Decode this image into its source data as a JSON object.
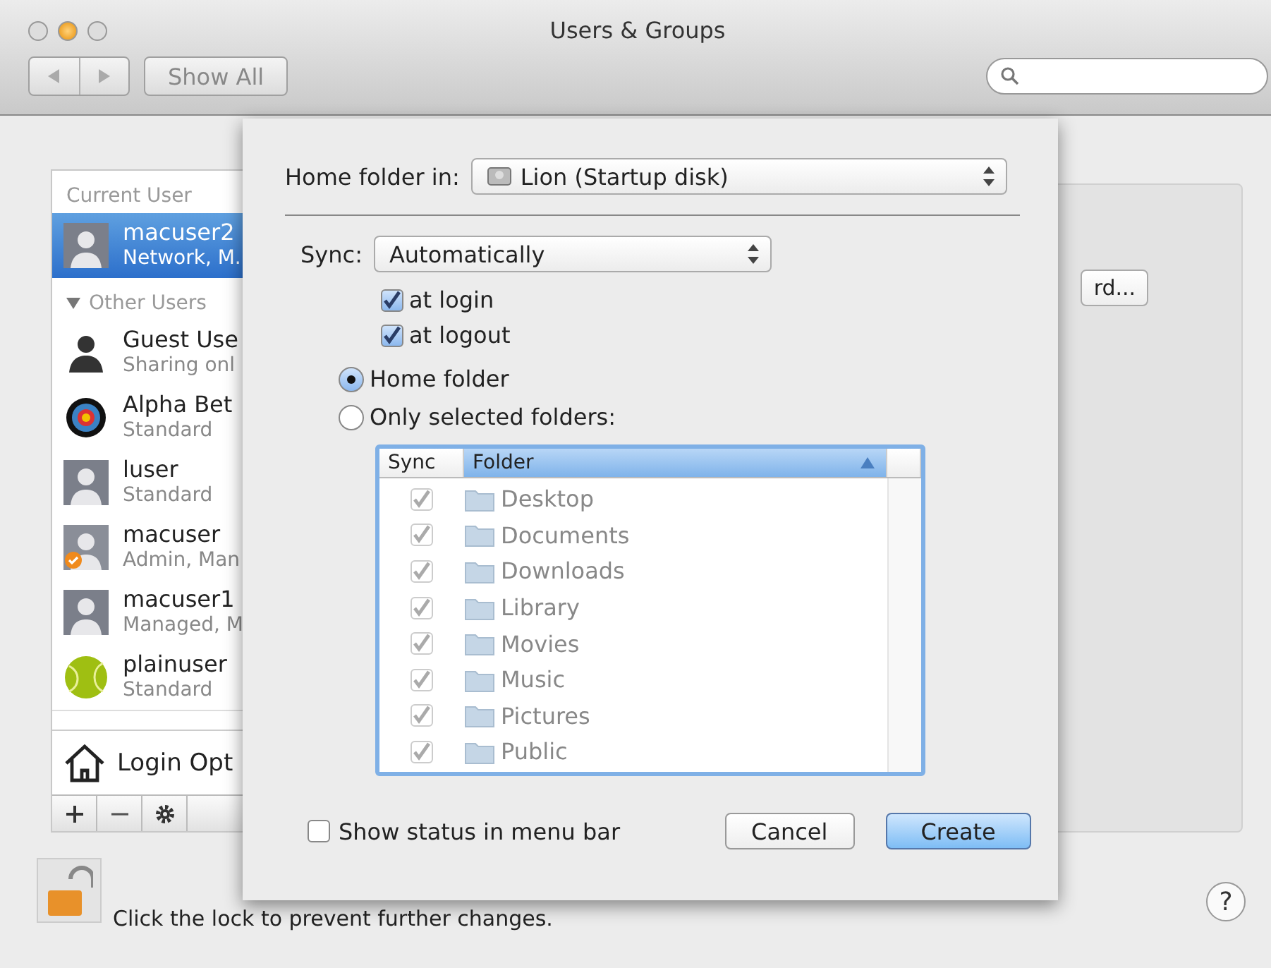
{
  "window": {
    "title": "Users & Groups"
  },
  "toolbar": {
    "show_all": "Show All"
  },
  "sidebar": {
    "current_header": "Current User",
    "current": {
      "name": "macuser2",
      "detail": "Network, M.",
      "kind": "silhouette",
      "selected": true
    },
    "other_header": "Other Users",
    "other_expanded": true,
    "users": [
      {
        "name": "Guest Use",
        "detail": "Sharing onl",
        "kind": "guest",
        "selected": false
      },
      {
        "name": "Alpha Bet",
        "detail": "Standard",
        "kind": "target",
        "selected": false
      },
      {
        "name": "luser",
        "detail": "Standard",
        "kind": "silhouette",
        "selected": false
      },
      {
        "name": "macuser",
        "detail": "Admin, Man",
        "kind": "admin",
        "selected": false
      },
      {
        "name": "macuser1",
        "detail": "Managed, M",
        "kind": "silhouette",
        "selected": false
      },
      {
        "name": "plainuser",
        "detail": "Standard",
        "kind": "ball",
        "selected": false
      }
    ],
    "login_options": "Login Opt"
  },
  "panel": {
    "change_password": "rd..."
  },
  "lock": {
    "locked": false,
    "text": "Click the lock to prevent further changes."
  },
  "help": "?",
  "sheet": {
    "home_folder": {
      "label": "Home folder in:",
      "value": "Lion (Startup disk)"
    },
    "sync": {
      "label": "Sync:",
      "value": "Automatically"
    },
    "sync_options": [
      {
        "label": "at login",
        "checked": true
      },
      {
        "label": "at logout",
        "checked": true
      }
    ],
    "scope": [
      {
        "label": "Home folder",
        "selected": true
      },
      {
        "label": "Only selected folders:",
        "selected": false
      }
    ],
    "table": {
      "columns": [
        "Sync",
        "Folder"
      ],
      "sort_ascending": true,
      "disabled": true,
      "rows": [
        {
          "checked": true,
          "folder": "Desktop"
        },
        {
          "checked": true,
          "folder": "Documents"
        },
        {
          "checked": true,
          "folder": "Downloads"
        },
        {
          "checked": true,
          "folder": "Library"
        },
        {
          "checked": true,
          "folder": "Movies"
        },
        {
          "checked": true,
          "folder": "Music"
        },
        {
          "checked": true,
          "folder": "Pictures"
        },
        {
          "checked": true,
          "folder": "Public"
        }
      ]
    },
    "show_status": {
      "label": "Show status in menu bar",
      "checked": false
    },
    "buttons": [
      {
        "label": "Cancel",
        "default": false
      },
      {
        "label": "Create",
        "default": true
      }
    ]
  }
}
